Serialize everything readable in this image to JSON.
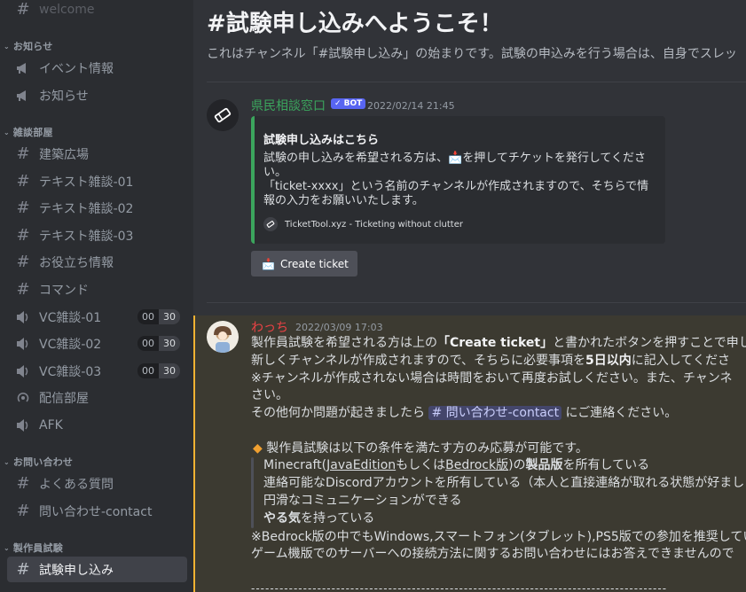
{
  "sidebar": {
    "top_channel": "welcome",
    "categories": [
      {
        "name": "お知らせ",
        "channels": [
          {
            "label": "イベント情報"
          },
          {
            "label": "お知らせ"
          }
        ]
      },
      {
        "name": "雑談部屋",
        "channels": [
          {
            "label": "建築広場"
          },
          {
            "label": "テキスト雑談-01"
          },
          {
            "label": "テキスト雑談-02"
          },
          {
            "label": "テキスト雑談-03"
          },
          {
            "label": "お役立ち情報"
          },
          {
            "label": "コマンド"
          },
          {
            "label": "VC雑談-01",
            "count_a": "00",
            "count_b": "30"
          },
          {
            "label": "VC雑談-02",
            "count_a": "00",
            "count_b": "30"
          },
          {
            "label": "VC雑談-03",
            "count_a": "00",
            "count_b": "30"
          },
          {
            "label": "配信部屋"
          },
          {
            "label": "AFK"
          }
        ]
      },
      {
        "name": "お問い合わせ",
        "channels": [
          {
            "label": "よくある質問"
          },
          {
            "label": "問い合わせ-contact"
          }
        ]
      },
      {
        "name": "製作員試験",
        "channels": [
          {
            "label": "試験申し込み"
          }
        ]
      }
    ]
  },
  "main": {
    "title": "#試験申し込みへようこそ！",
    "description": "これはチャンネル「#試験申し込み」の始まりです。試験の申込みを行う場合は、自身でスレッ",
    "msg1": {
      "author": "県民相談窓口",
      "bot_badge": "✓ BOT",
      "timestamp": "2022/02/14 21:45",
      "author_color": "#3ba55d",
      "embed": {
        "title": "試験申し込みはこちら",
        "desc_1": "試験の申し込みを希望される方は、",
        "desc_2": "を押してチケットを発行してください。",
        "desc_3": "「ticket-xxxx」という名前のチャンネルが作成されますので、そちらで情報の入力をお願いいたします。",
        "footer": "TicketTool.xyz - Ticketing without clutter"
      },
      "button": "Create ticket"
    },
    "msg2": {
      "author": "わっち",
      "author_color": "#ed4245",
      "timestamp": "2022/03/09 17:03",
      "l1a": "製作員試験を希望される方は上の",
      "l1b": "「Create ticket」",
      "l1c": "と書かれたボタンを押すことで申し",
      "l2a": "新しくチャンネルが作成されますので、そちらに必要事項を",
      "l2b": "5日以内",
      "l2c": "に記入してくださ",
      "l3": "※チャンネルが作成されない場合は時間をおいて再度お試しください。また、チャンネ",
      "l4": "さい。",
      "l5a": "その他何か問題が起きましたら",
      "mention": "# 問い合わせ-contact",
      "l5b": "にご連絡ください。",
      "l6": "製作員試験は以下の条件を満たす方のみ応募が可能です。",
      "q1a": "Minecraft(",
      "q1b": "JavaEdition",
      "q1c": "もしくは",
      "q1d": "Bedrock版",
      "q1e": ")の",
      "q1f": "製品版",
      "q1g": "を所有している",
      "q2": "連絡可能なDiscordアカウントを所有している（本人と直接連絡が取れる状態が好まし",
      "q3": "円滑なコミュニケーションができる",
      "q4a": "やる気",
      "q4b": "を持っている",
      "l7": "※Bedrock版の中でもWindows,スマートフォン(タブレット),PS5版での参加を推奨してい",
      "l8": "ゲーム機版でのサーバーへの接続方法に関するお問い合わせにはお答えできませんので",
      "dashes": "----------------------------------------------------------------------------------------"
    }
  }
}
